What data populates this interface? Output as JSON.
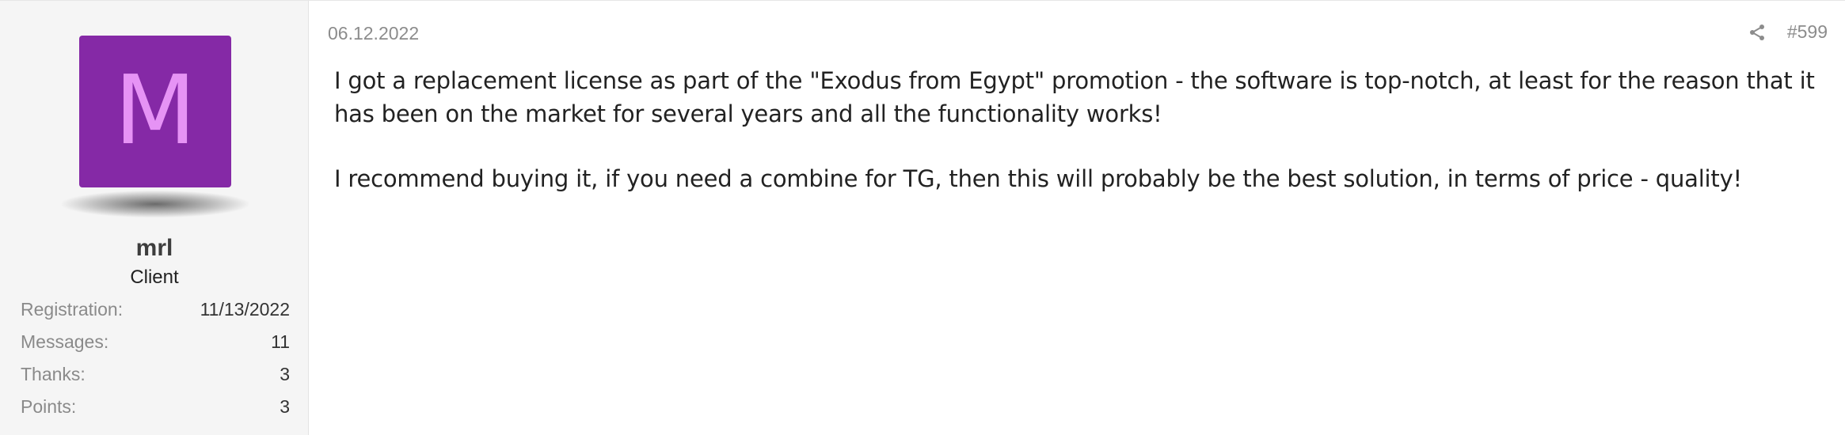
{
  "post": {
    "date": "06.12.2022",
    "number": "#599",
    "paragraphs": [
      "I got a replacement license as part of the \"Exodus from Egypt\" promotion - the software is top-notch, at least for the reason that it has been on the market for several years and all the functionality works!",
      "I recommend buying it, if you need a combine for TG, then this will probably be the best solution, in terms of price - quality!"
    ],
    "share_icon": "share-icon"
  },
  "user": {
    "avatar_letter": "M",
    "avatar_color": "#8529a6",
    "avatar_letter_color": "#e693f5",
    "name": "mrl",
    "role": "Client",
    "stats": [
      {
        "label": "Registration:",
        "value": "11/13/2022"
      },
      {
        "label": "Messages:",
        "value": "11"
      },
      {
        "label": "Thanks:",
        "value": "3"
      },
      {
        "label": "Points:",
        "value": "3"
      }
    ]
  }
}
